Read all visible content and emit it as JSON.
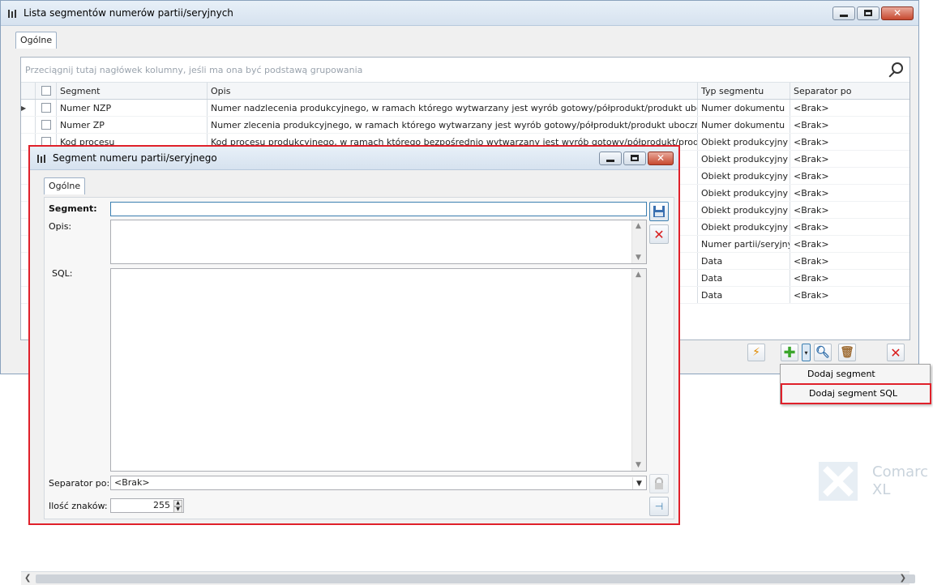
{
  "watermark": {
    "line1": "Comarc",
    "line2": "XL"
  },
  "main_window": {
    "title": "Lista segmentów numerów partii/seryjnych",
    "tab": "Ogólne",
    "group_hint": "Przeciągnij tutaj nagłówek kolumny, jeśli ma ona być podstawą grupowania",
    "columns": {
      "segment": "Segment",
      "opis": "Opis",
      "typ": "Typ segmentu",
      "separator": "Separator po"
    },
    "rows": [
      {
        "segment": "Numer NZP",
        "opis": "Numer nadzlecenia produkcyjnego, w ramach którego wytwarzany jest wyrób gotowy/półprodukt/produkt uboczny",
        "typ": "Numer dokumentu",
        "separator": "<Brak>"
      },
      {
        "segment": "Numer ZP",
        "opis": "Numer zlecenia produkcyjnego, w ramach którego wytwarzany jest wyrób gotowy/półprodukt/produkt uboczny",
        "typ": "Numer dokumentu",
        "separator": "<Brak>"
      },
      {
        "segment": "Kod procesu",
        "opis": "Kod procesu produkcyjnego, w ramach którego bezpośrednio wytwarzany jest wyrób gotowy/półprodukt/produkt uboczny",
        "typ": "Obiekt produkcyjny",
        "separator": "<Brak>"
      },
      {
        "segment": "",
        "opis": "",
        "typ": "Obiekt produkcyjny",
        "separator": "<Brak>"
      },
      {
        "segment": "",
        "opis": "",
        "typ": "Obiekt produkcyjny",
        "separator": "<Brak>"
      },
      {
        "segment": "",
        "opis": "",
        "typ": "Obiekt produkcyjny",
        "separator": "<Brak>"
      },
      {
        "segment": "",
        "opis": "",
        "typ": "Obiekt produkcyjny",
        "separator": "<Brak>"
      },
      {
        "segment": "",
        "opis": "",
        "typ": "Obiekt produkcyjny",
        "separator": "<Brak>"
      },
      {
        "segment": "",
        "opis": "",
        "typ": "Numer partii/seryjny",
        "separator": "<Brak>"
      },
      {
        "segment": "",
        "opis": "",
        "typ": "Data",
        "separator": "<Brak>"
      },
      {
        "segment": "",
        "opis": "",
        "typ": "Data",
        "separator": "<Brak>"
      },
      {
        "segment": "",
        "opis": "",
        "typ": "Data",
        "separator": "<Brak>"
      }
    ]
  },
  "add_menu": {
    "items": [
      "Dodaj segment",
      "Dodaj segment SQL"
    ]
  },
  "dialog": {
    "title": "Segment numeru partii/seryjnego",
    "tab": "Ogólne",
    "segment_label": "Segment:",
    "segment_value": "",
    "opis_label": "Opis:",
    "opis_value": "",
    "sql_label": "SQL:",
    "sql_value": "",
    "separator_label": "Separator po:",
    "separator_value": "<Brak>",
    "ilosc_label": "Ilość znaków:",
    "ilosc_value": "255"
  },
  "colors": {
    "accent_red": "#e0202a",
    "title_bg": "#d6e2ef"
  }
}
